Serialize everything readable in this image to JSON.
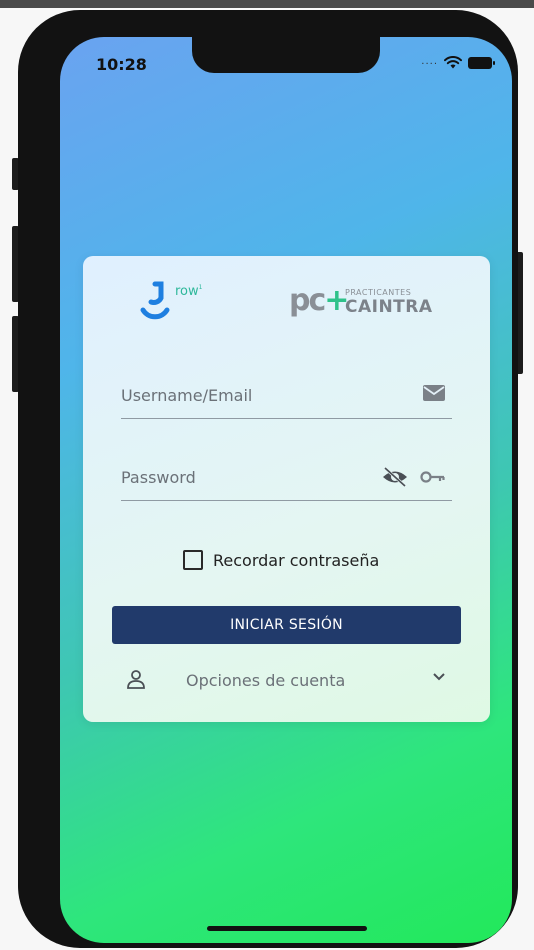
{
  "status_bar": {
    "time": "10:28",
    "icons": [
      "cellular-dots-icon",
      "wifi-icon",
      "battery-icon"
    ]
  },
  "logos": {
    "grow": {
      "text": "row",
      "superscript": "1"
    },
    "caintra": {
      "mark": "pc",
      "plus": "+",
      "small": "PRACTICANTES",
      "big": "CAINTRA"
    }
  },
  "form": {
    "username": {
      "placeholder": "Username/Email",
      "icon": "mail-icon"
    },
    "password": {
      "placeholder": "Password",
      "icons": [
        "eye-off-icon",
        "key-icon"
      ]
    },
    "remember": {
      "label": "Recordar contraseña",
      "checked": false
    },
    "login_button": "INICIAR SESIÓN",
    "account_options": {
      "label": "Opciones de cuenta",
      "icon": "person-icon",
      "chevron": "chevron-down-icon"
    }
  },
  "colors": {
    "button": "#213a6b",
    "gradient_top": "#6aa3f0",
    "gradient_bottom": "#22e85a",
    "grow_accent": "#1e7fe0",
    "caintra_accent": "#2fc28a"
  }
}
